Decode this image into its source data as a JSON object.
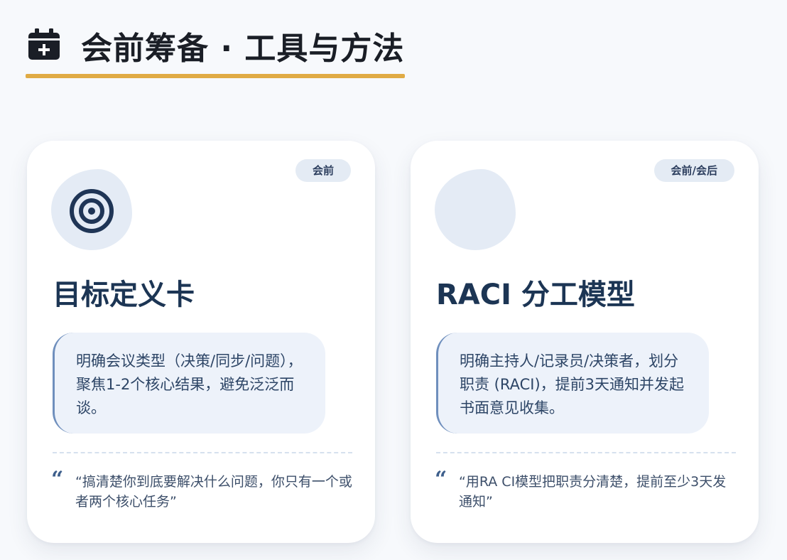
{
  "header": {
    "title": "会前筹备 · 工具与方法"
  },
  "colors": {
    "accent": "#e0ab45",
    "title": "#1c3554",
    "tag_bg": "#e4ebf4",
    "desc_bg": "#edf2fa",
    "quote_mark": "#3e5f8c"
  },
  "cards": [
    {
      "tag": "会前",
      "icon": "target-icon",
      "title": "目标定义卡",
      "description": "明确会议类型（决策/同步/问题），聚焦1-2个核心结果，避免泛泛而谈。",
      "quote": "“搞清楚你到底要解决什么问题，你只有一个或者两个核心任务”"
    },
    {
      "tag": "会前/会后",
      "icon": "blank-icon",
      "title": "RACI 分工模型",
      "description": "明确主持人/记录员/决策者，划分职责 (RACI)，提前3天通知并发起书面意见收集。",
      "quote": "“用RA CI模型把职责分清楚，提前至少3天发通知”"
    }
  ]
}
